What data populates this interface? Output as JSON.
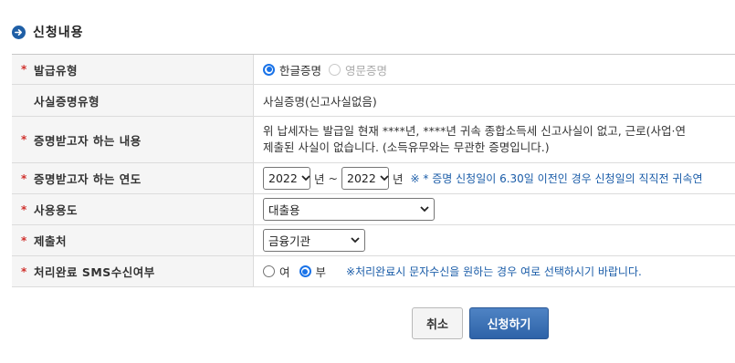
{
  "section": {
    "title": "신청내용",
    "icon": "arrow-right-circle-icon"
  },
  "required_mark": "*",
  "rows": {
    "issue_type": {
      "label": "발급유형",
      "options": [
        {
          "label": "한글증명",
          "checked": true,
          "disabled": false
        },
        {
          "label": "영문증명",
          "checked": false,
          "disabled": true
        }
      ]
    },
    "cert_type": {
      "label": "사실증명유형",
      "value": "사실증명(신고사실없음)"
    },
    "content": {
      "label": "증명받고자 하는 내용",
      "line1": "위 납세자는 발급일 현재 ****년, ****년 귀속 종합소득세 신고사실이 없고, 근로(사업·연",
      "line2": "제출된 사실이 없습니다. (소득유무와는 무관한 증명입니다.)"
    },
    "year": {
      "label": "증명받고자 하는 연도",
      "from": "2022",
      "from_unit": "년",
      "tilde": "~",
      "to": "2022",
      "to_unit": "년",
      "note_mark": "※",
      "note": "* 증명 신청일이 6.30일 이전인 경우 신청일의 직직전 귀속연"
    },
    "purpose": {
      "label": "사용용도",
      "value": "대출용"
    },
    "submit_to": {
      "label": "제출처",
      "value": "금융기관"
    },
    "sms": {
      "label": "처리완료 SMS수신여부",
      "options": [
        {
          "label": "여",
          "checked": false
        },
        {
          "label": "부",
          "checked": true
        }
      ],
      "note": "※처리완료시 문자수신을 원하는 경우 여로 선택하시기 바랍니다."
    }
  },
  "buttons": {
    "cancel": "취소",
    "apply": "신청하기"
  },
  "colors": {
    "accent": "#1f5fa6",
    "required": "#d0312d",
    "note": "#1a5ca8"
  }
}
